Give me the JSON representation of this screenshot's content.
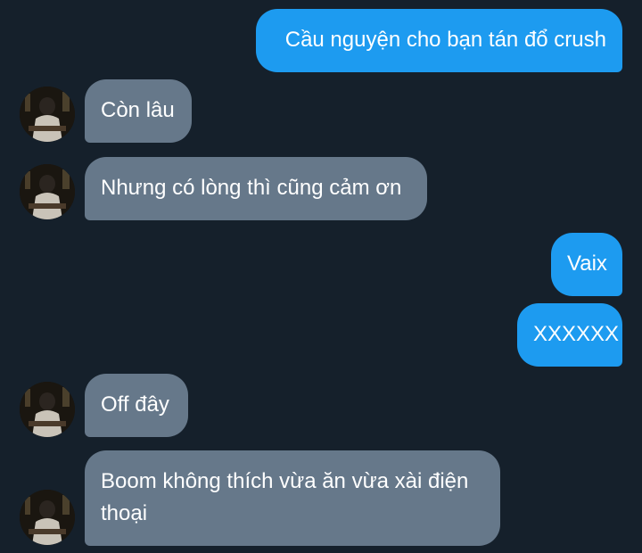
{
  "colors": {
    "background": "#15202b",
    "outgoing_bubble": "#1d9bf0",
    "incoming_bubble": "#66788a",
    "text": "#ffffff"
  },
  "messages": [
    {
      "direction": "outgoing",
      "text": "Cầu nguyện cho bạn tán đổ crush"
    },
    {
      "direction": "incoming",
      "text": "Còn lâu",
      "avatar": "user-avatar"
    },
    {
      "direction": "incoming",
      "text": "Nhưng có lòng thì cũng cảm ơn",
      "avatar": "user-avatar"
    },
    {
      "direction": "outgoing",
      "text": "Vaix"
    },
    {
      "direction": "outgoing",
      "text": "XXXXXX"
    },
    {
      "direction": "incoming",
      "text": "Off đây",
      "avatar": "user-avatar"
    },
    {
      "direction": "incoming",
      "text": "Boom không thích vừa ăn vừa xài điện thoại",
      "avatar": "user-avatar"
    }
  ]
}
